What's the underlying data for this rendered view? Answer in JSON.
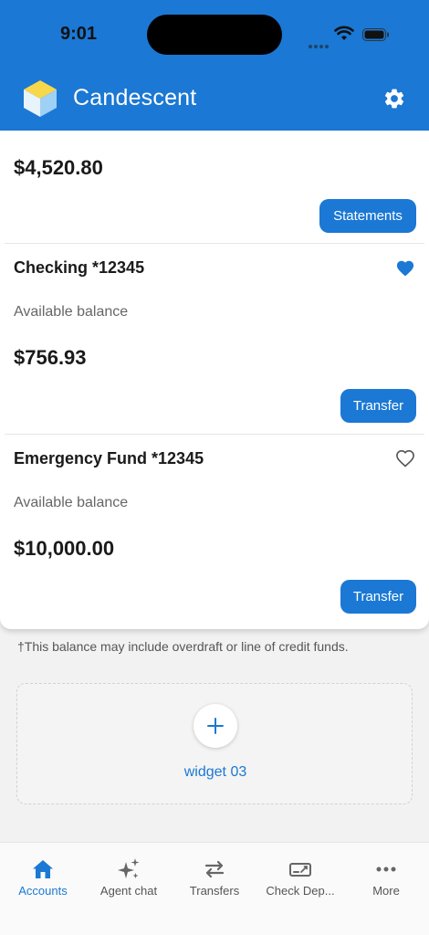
{
  "status_bar": {
    "time": "9:01"
  },
  "app": {
    "title": "Candescent"
  },
  "summary": {
    "total_balance": "$4,520.80",
    "statements_label": "Statements"
  },
  "accounts": [
    {
      "name": "Checking *12345",
      "available_label": "Available balance",
      "balance": "$756.93",
      "transfer_label": "Transfer",
      "favorite": true
    },
    {
      "name": "Emergency Fund *12345",
      "available_label": "Available balance",
      "balance": "$10,000.00",
      "transfer_label": "Transfer",
      "favorite": false
    }
  ],
  "footnote": "†This balance may include overdraft or line of credit funds.",
  "widget": {
    "label": "widget 03"
  },
  "tabs": [
    {
      "label": "Accounts",
      "icon": "home-icon",
      "active": true
    },
    {
      "label": "Agent chat",
      "icon": "sparkles-icon",
      "active": false
    },
    {
      "label": "Transfers",
      "icon": "transfer-arrows-icon",
      "active": false
    },
    {
      "label": "Check Dep...",
      "icon": "check-deposit-icon",
      "active": false
    },
    {
      "label": "More",
      "icon": "more-dots-icon",
      "active": false
    }
  ],
  "colors": {
    "brand": "#1b78d4",
    "background": "#f2f2f2",
    "card": "#ffffff"
  }
}
